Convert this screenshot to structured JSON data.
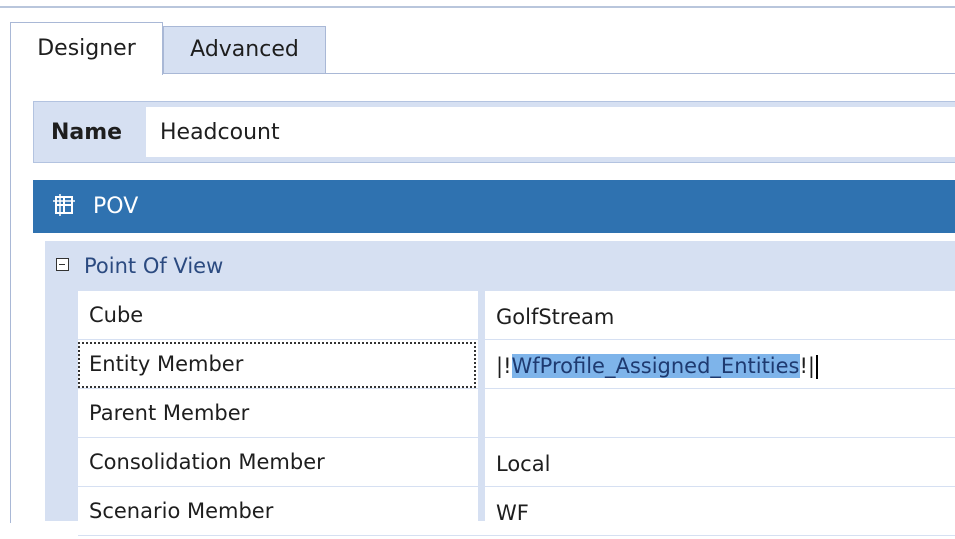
{
  "tabs": [
    {
      "label": "Designer",
      "active": true
    },
    {
      "label": "Advanced",
      "active": false
    }
  ],
  "name_field": {
    "label": "Name",
    "value": "Headcount"
  },
  "pov": {
    "title": "POV",
    "icon": "cube-grid-icon",
    "category": "Point Of View",
    "rows": [
      {
        "label": "Cube",
        "value": "GolfStream"
      },
      {
        "label": "Entity Member",
        "value_prefix": "|!",
        "value_selected": "WfProfile_Assigned_Entities",
        "value_suffix": "!|"
      },
      {
        "label": "Parent Member",
        "value": ""
      },
      {
        "label": "Consolidation Member",
        "value": "Local"
      },
      {
        "label": "Scenario Member",
        "value": "WF"
      }
    ]
  },
  "colors": {
    "accent_header": "#2f72b0",
    "panel_light": "#d6e0f2",
    "selection": "#7eb4ea"
  }
}
